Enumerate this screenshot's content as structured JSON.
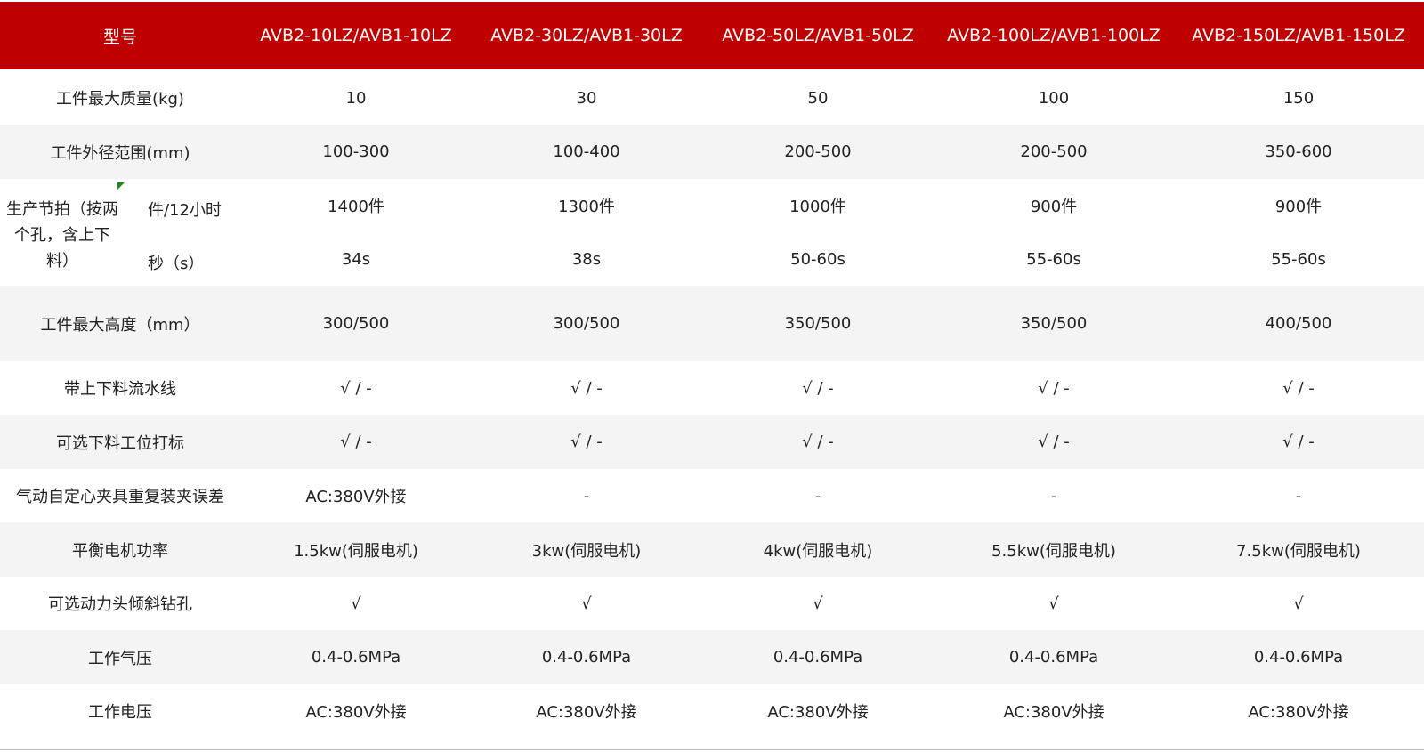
{
  "header": {
    "label": "型号",
    "models": [
      "AVB2-10LZ/AVB1-10LZ",
      "AVB2-30LZ/AVB1-30LZ",
      "AVB2-50LZ/AVB1-50LZ",
      "AVB2-100LZ/AVB1-100LZ",
      "AVB2-150LZ/AVB1-150LZ"
    ]
  },
  "rows": {
    "max_mass": {
      "label": "工件最大质量(kg)",
      "values": [
        "10",
        "30",
        "50",
        "100",
        "150"
      ]
    },
    "outer_dia": {
      "label": "工件外径范围(mm)",
      "values": [
        "100-300",
        "100-400",
        "200-500",
        "200-500",
        "350-600"
      ]
    },
    "cycle": {
      "label": "生产节拍（按两个孔，含上下料）",
      "pieces_label": "件/12小时",
      "pieces": [
        "1400件",
        "1300件",
        "1000件",
        "900件",
        "900件"
      ],
      "seconds_label": "秒（s）",
      "seconds": [
        "34s",
        "38s",
        "50-60s",
        "55-60s",
        "55-60s"
      ]
    },
    "max_height": {
      "label": "工件最大高度（mm）",
      "values": [
        "300/500",
        "300/500",
        "350/500",
        "350/500",
        "400/500"
      ]
    },
    "conveyor": {
      "label": "带上下料流水线",
      "values": [
        "√ / -",
        "√ / -",
        "√ / -",
        "√ / -",
        "√ / -"
      ]
    },
    "marking": {
      "label": "可选下料工位打标",
      "values": [
        "√ / -",
        "√ / -",
        "√ / -",
        "√ / -",
        "√ / -"
      ]
    },
    "clamp_error": {
      "label": "气动自定心夹具重复装夹误差",
      "values": [
        "AC:380V外接",
        "-",
        "-",
        "-",
        "-"
      ]
    },
    "motor_power": {
      "label": "平衡电机功率",
      "values": [
        "1.5kw(伺服电机)",
        "3kw(伺服电机)",
        "4kw(伺服电机)",
        "5.5kw(伺服电机)",
        "7.5kw(伺服电机)"
      ]
    },
    "angled_drill": {
      "label": "可选动力头倾斜钻孔",
      "values": [
        "√",
        "√",
        "√",
        "√",
        "√"
      ]
    },
    "air_pressure": {
      "label": "工作气压",
      "values": [
        "0.4-0.6MPa",
        "0.4-0.6MPa",
        "0.4-0.6MPa",
        "0.4-0.6MPa",
        "0.4-0.6MPa"
      ]
    },
    "voltage": {
      "label": "工作电压",
      "values": [
        "AC:380V外接",
        "AC:380V外接",
        "AC:380V外接",
        "AC:380V外接",
        "AC:380V外接"
      ]
    }
  },
  "colors": {
    "header_bg": "#bf0000",
    "alt_row_bg": "#f4f4f4",
    "marker": "#1b8a1b"
  }
}
